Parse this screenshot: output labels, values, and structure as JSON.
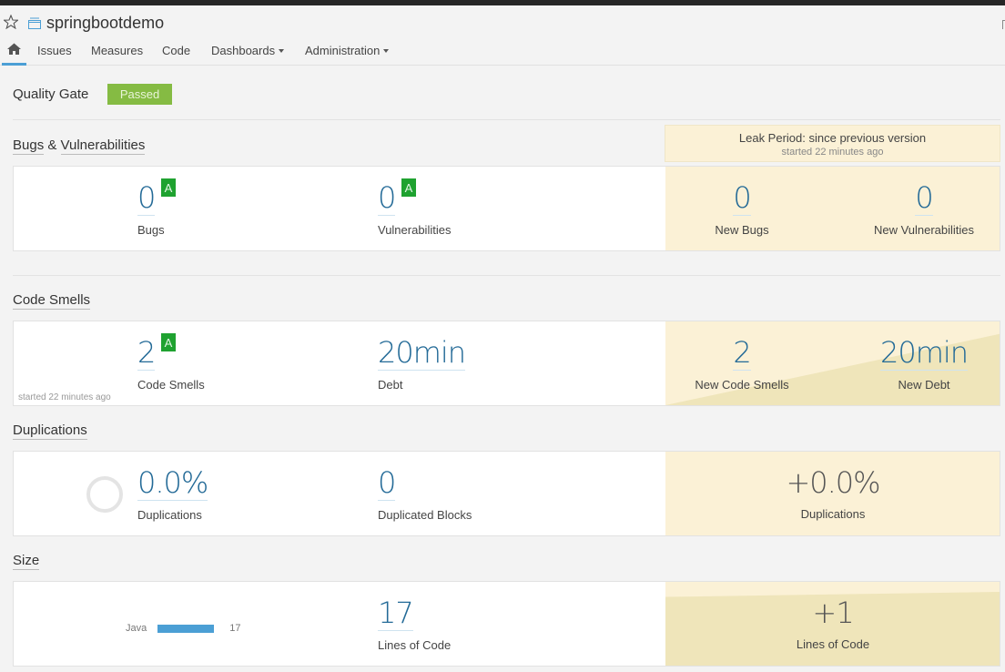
{
  "project": {
    "name": "springbootdemo",
    "favorite_icon": "star-outline-icon",
    "project_icon": "project-icon"
  },
  "nav": {
    "home_icon": "home-icon",
    "items": [
      {
        "label": "Issues"
      },
      {
        "label": "Measures"
      },
      {
        "label": "Code"
      },
      {
        "label": "Dashboards",
        "dropdown": true
      },
      {
        "label": "Administration",
        "dropdown": true
      }
    ]
  },
  "quality_gate": {
    "label": "Quality Gate",
    "status": "Passed",
    "status_color": "#85bb43"
  },
  "leak_period": {
    "title": "Leak Period: since previous version",
    "started": "started 22 minutes ago"
  },
  "sections": {
    "bugs": {
      "title_a": "Bugs",
      "title_amp": " & ",
      "title_b": "Vulnerabilities",
      "bugs": {
        "value": "0",
        "label": "Bugs",
        "rating": "A"
      },
      "vulnerabilities": {
        "value": "0",
        "label": "Vulnerabilities",
        "rating": "A"
      },
      "new_bugs": {
        "value": "0",
        "label": "New Bugs"
      },
      "new_vulnerabilities": {
        "value": "0",
        "label": "New Vulnerabilities"
      }
    },
    "code_smells": {
      "title": "Code Smells",
      "started": "started 22 minutes ago",
      "code_smells": {
        "value": "2",
        "label": "Code Smells",
        "rating": "A"
      },
      "debt": {
        "value": "20min",
        "label": "Debt"
      },
      "new_code_smells": {
        "value": "2",
        "label": "New Code Smells"
      },
      "new_debt": {
        "value": "20min",
        "label": "New Debt"
      }
    },
    "duplications": {
      "title": "Duplications",
      "duplications": {
        "value": "0.0%",
        "label": "Duplications"
      },
      "duplicated_blocks": {
        "value": "0",
        "label": "Duplicated Blocks"
      },
      "new_duplications": {
        "value": "+0.0%",
        "label": "Duplications"
      }
    },
    "size": {
      "title": "Size",
      "languages": [
        {
          "name": "Java",
          "value": "17"
        }
      ],
      "lines_of_code": {
        "value": "17",
        "label": "Lines of Code"
      },
      "new_lines": {
        "value": "+1",
        "label": "Lines of Code"
      }
    }
  },
  "colors": {
    "rating_a": "#1fa230",
    "leak_bg": "#fbf1d6",
    "accent": "#4b9fd5",
    "metric_value": "#236a97"
  }
}
